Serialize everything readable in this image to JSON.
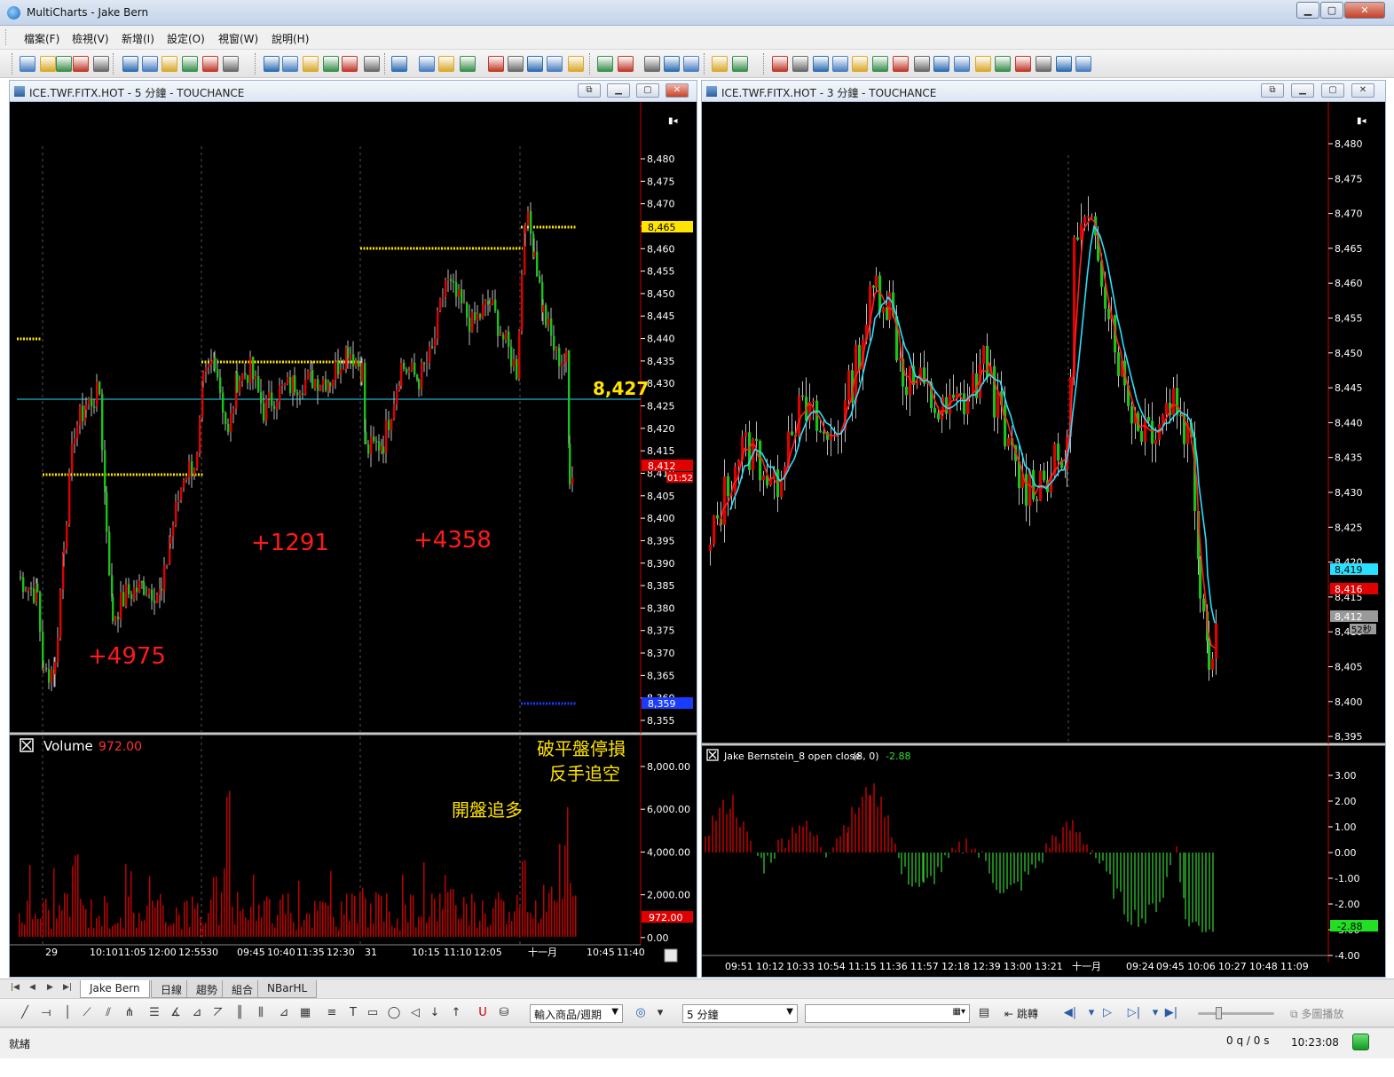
{
  "app": {
    "title": "MultiCharts - Jake Bern"
  },
  "menu": [
    "檔案(F)",
    "檢視(V)",
    "新增(I)",
    "設定(O)",
    "視窗(W)",
    "說明(H)"
  ],
  "left_window": {
    "title": "ICE.TWF.FITX.HOT - 5 分鐘 - TOUCHANCE",
    "price_label_last": "8,427",
    "price_tag_yellow": "8,465",
    "price_tag_red": "8,412",
    "price_tag_timer": "01:52",
    "price_tag_blue": "8,359",
    "annotations": {
      "a1": "+4975",
      "a2": "+1291",
      "a3": "+4358"
    },
    "volume_title": "Volume",
    "volume_value": "972.00",
    "volume_tag": "972.00",
    "note_stop": "破平盤停損",
    "note_reverse": "反手追空",
    "note_open": "開盤追多",
    "price_axis": [
      "8,480",
      "8,475",
      "8,470",
      "8,465",
      "8,460",
      "8,455",
      "8,450",
      "8,445",
      "8,440",
      "8,435",
      "8,430",
      "8,425",
      "8,420",
      "8,415",
      "8,410",
      "8,405",
      "8,400",
      "8,395",
      "8,390",
      "8,385",
      "8,380",
      "8,375",
      "8,370",
      "8,365",
      "8,360",
      "8,355"
    ],
    "volume_axis": [
      "8,000.00",
      "6,000.00",
      "4,000.00",
      "2,000.00",
      "0.00"
    ],
    "time_axis": [
      "29",
      "10:10",
      "11:05",
      "12:00",
      "12:55",
      "30",
      "09:45",
      "10:40",
      "11:35",
      "12:30",
      "31",
      "10:15",
      "11:10",
      "12:05",
      "十一月",
      "10:45",
      "11:40"
    ]
  },
  "right_window": {
    "title": "ICE.TWF.FITX.HOT - 3 分鐘 - TOUCHANCE",
    "price_axis": [
      "8,480",
      "8,475",
      "8,470",
      "8,465",
      "8,460",
      "8,455",
      "8,450",
      "8,445",
      "8,440",
      "8,435",
      "8,430",
      "8,425",
      "8,420",
      "8,415",
      "8,410",
      "8,405",
      "8,400",
      "8,395"
    ],
    "tag_cyan": "8,419",
    "tag_red": "8,416",
    "tag_gray": "8,412",
    "tag_timer": "52秒",
    "indicator_title": "Jake Bernstein_8 open close",
    "indicator_params": "(8,  0)",
    "indicator_value": "-2.88",
    "indicator_axis": [
      "3.00",
      "2.00",
      "1.00",
      "0.00",
      "-1.00",
      "-2.00",
      "-3.00",
      "-4.00"
    ],
    "indicator_tag": "-2.88",
    "time_axis": [
      "09:51",
      "10:12",
      "10:33",
      "10:54",
      "11:15",
      "11:36",
      "11:57",
      "12:18",
      "12:39",
      "13:00",
      "13:21",
      "十一月",
      "09:24",
      "09:45",
      "10:06",
      "10:27",
      "10:48",
      "11:09"
    ]
  },
  "tabs": [
    "Jake Bern",
    "日線",
    "趨勢",
    "組合",
    "NBarHL"
  ],
  "drawbar": {
    "symbol_combo": "輸入商品/週期",
    "interval_combo": "5 分鐘",
    "jump_label": "跳轉",
    "multi_play": "多圖播放"
  },
  "status": {
    "text": "就緒",
    "quotes": "0 q / 0 s",
    "time": "10:23:08"
  },
  "colors": {
    "up": "#e00000",
    "down": "#18c418",
    "level": "#ffe400",
    "cyan": "#28e0ff",
    "chart_bg": "#000000"
  }
}
